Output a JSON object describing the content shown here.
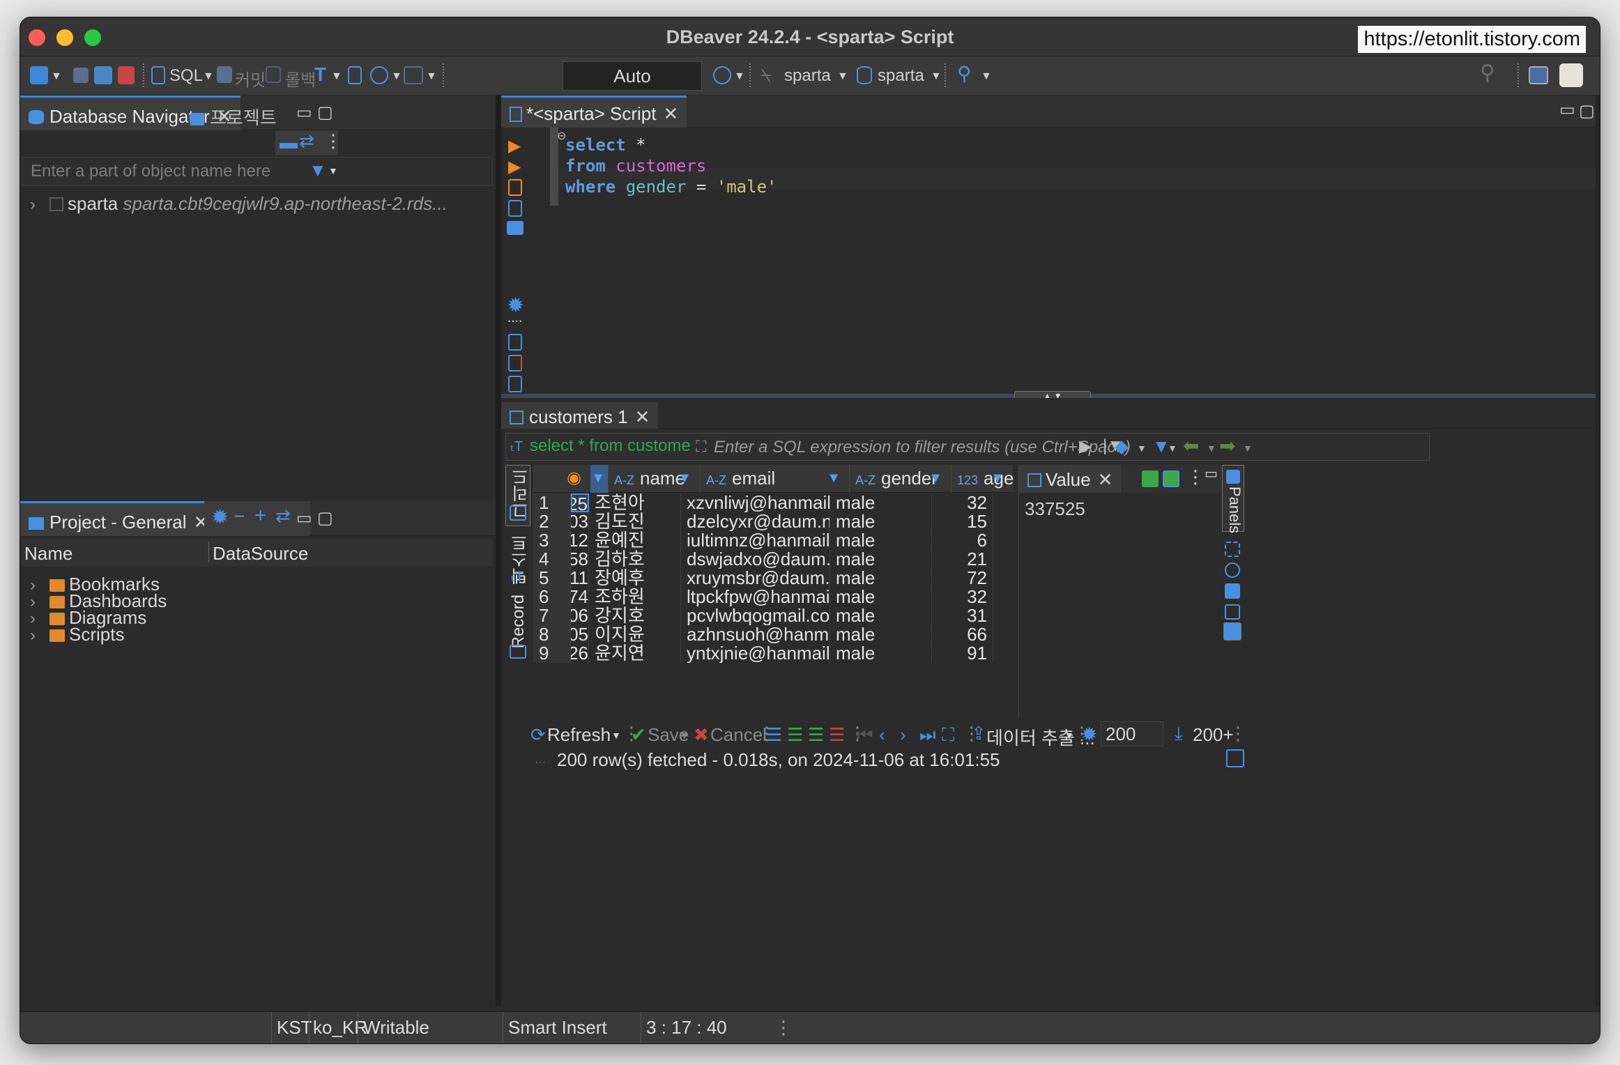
{
  "window": {
    "title": "DBeaver 24.2.4 - <sparta> Script",
    "url": "https://etonlit.tistory.com"
  },
  "toolbar": {
    "sql_label": "SQL",
    "commit_label": "커밋",
    "rollback_label": "롤백",
    "mode_label": "Auto",
    "datasource_label": "sparta",
    "schema_label": "sparta"
  },
  "navigator": {
    "tab_label": "Database Navigator",
    "project_tab_label": "프로젝트",
    "filter_placeholder": "Enter a part of object name here",
    "connection_name": "sparta",
    "connection_host": "sparta.cbt9ceqjwlr9.ap-northeast-2.rds..."
  },
  "project": {
    "tab_label": "Project - General",
    "col_name": "Name",
    "col_datasource": "DataSource",
    "items": [
      "Bookmarks",
      "Dashboards",
      "Diagrams",
      "Scripts"
    ]
  },
  "editor": {
    "tab_label": "*<sparta> Script",
    "lines": [
      {
        "kw": "select",
        "rest": " *"
      },
      {
        "kw": "from",
        "table": " customers"
      },
      {
        "kw": "where",
        "column": " gender",
        "op": " = ",
        "str": "'male'"
      }
    ]
  },
  "results": {
    "tab_label": "customers 1",
    "query_text": "select * from customers whe",
    "filter_placeholder": "Enter a SQL expression to filter results (use Ctrl+Space)",
    "side_tab_grid": "그리드",
    "side_tab_text": "텍스트",
    "side_tab_record": "Record",
    "columns": [
      {
        "type": "A-Z",
        "name": "name"
      },
      {
        "type": "A-Z",
        "name": "email"
      },
      {
        "type": "A-Z",
        "name": "gender"
      },
      {
        "type": "123",
        "name": "age"
      }
    ],
    "rows": [
      {
        "n": "1",
        "id": "25",
        "name": "조현아",
        "email": "xzvnliwj@hanmail.com",
        "gender": "male",
        "age": "32"
      },
      {
        "n": "2",
        "id": "03",
        "name": "김도진",
        "email": "dzelcyxr@daum.net",
        "gender": "male",
        "age": "15"
      },
      {
        "n": "3",
        "id": "12",
        "name": "윤예진",
        "email": "iultimnz@hanmail.com",
        "gender": "male",
        "age": "6"
      },
      {
        "n": "4",
        "id": "58",
        "name": "김하호",
        "email": "dswjadxo@daum.net",
        "gender": "male",
        "age": "21"
      },
      {
        "n": "5",
        "id": "11",
        "name": "장예후",
        "email": "xruymsbr@daum.net",
        "gender": "male",
        "age": "72"
      },
      {
        "n": "6",
        "id": "74",
        "name": "조하원",
        "email": "ltpckfpw@hanmail.com",
        "gender": "male",
        "age": "32"
      },
      {
        "n": "7",
        "id": "06",
        "name": "강지호",
        "email": "pcvlwbqogmail.com",
        "gender": "male",
        "age": "31"
      },
      {
        "n": "8",
        "id": "05",
        "name": "이지윤",
        "email": "azhnsuoh@hanmail.com",
        "gender": "male",
        "age": "66"
      },
      {
        "n": "9",
        "id": "26",
        "name": "윤지연",
        "email": "yntxjnie@hanmail.com",
        "gender": "male",
        "age": "91"
      }
    ],
    "value_panel_label": "Value",
    "value_panel_value": "337525",
    "panels_label": "Panels",
    "bottom": {
      "refresh": "Refresh",
      "save": "Save",
      "cancel": "Cancel",
      "export": "데이터 추출 ...",
      "fetch_size": "200",
      "fetched_count": "200+"
    },
    "status_message": "200 row(s) fetched - 0.018s, on 2024-11-06 at 16:01:55"
  },
  "statusbar": {
    "timezone": "KST",
    "locale": "ko_KR",
    "mode": "Writable",
    "insert_mode": "Smart Insert",
    "position": "3 : 17 : 40"
  }
}
